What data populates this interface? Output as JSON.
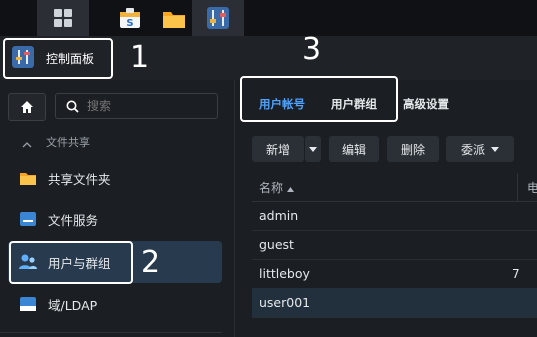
{
  "taskbar": {
    "grid_icon": "main-menu-icon",
    "apps": [
      "package-center-icon",
      "file-station-icon",
      "control-panel-icon"
    ]
  },
  "window": {
    "title": "控制面板"
  },
  "annotations": [
    "1",
    "2",
    "3"
  ],
  "sidebar": {
    "search_placeholder": "搜索",
    "section": "文件共享",
    "items": [
      {
        "label": "共享文件夹",
        "icon": "folder-icon"
      },
      {
        "label": "文件服务",
        "icon": "file-services-icon"
      },
      {
        "label": "用户与群组",
        "icon": "users-icon",
        "selected": true
      },
      {
        "label": "域/LDAP",
        "icon": "domain-icon"
      }
    ]
  },
  "tabs": [
    {
      "label": "用户帐号",
      "active": true
    },
    {
      "label": "用户群组",
      "active": false
    },
    {
      "label": "高级设置",
      "active": false
    }
  ],
  "toolbar": {
    "create": "新增",
    "edit": "编辑",
    "delete": "删除",
    "delegate": "委派"
  },
  "table": {
    "col_name": "名称",
    "col_partial": "电",
    "rows": [
      {
        "name": "admin",
        "extra": ""
      },
      {
        "name": "guest",
        "extra": ""
      },
      {
        "name": "littleboy",
        "extra": "7"
      },
      {
        "name": "user001",
        "extra": "",
        "selected": true
      }
    ]
  },
  "colors": {
    "accent": "#4fa3ff",
    "selected_bg": "#273a4e"
  }
}
